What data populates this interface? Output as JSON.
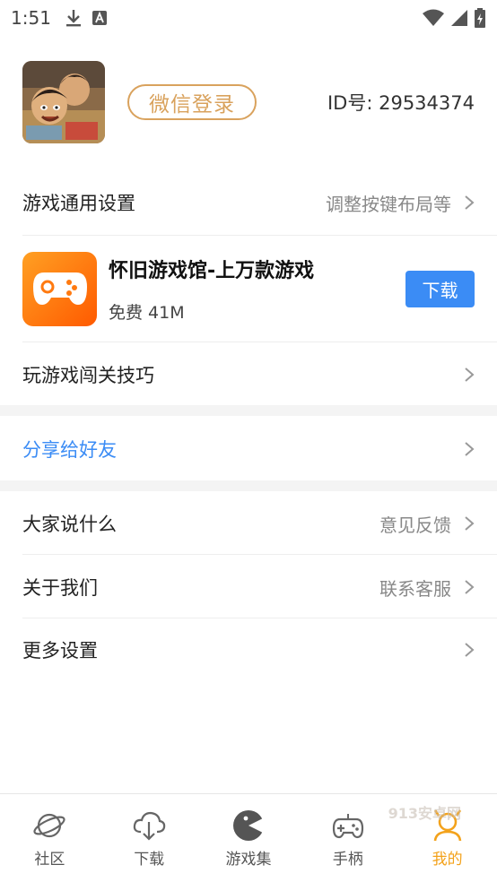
{
  "status_bar": {
    "time": "1:51"
  },
  "profile": {
    "login_label": "微信登录",
    "user_id": "ID号: 29534374"
  },
  "menu": {
    "game_settings": {
      "label": "游戏通用设置",
      "hint": "调整按键布局等"
    },
    "tips": {
      "label": "玩游戏闯关技巧"
    },
    "share": {
      "label": "分享给好友"
    },
    "feedback": {
      "label": "大家说什么",
      "hint": "意见反馈"
    },
    "about": {
      "label": "关于我们",
      "hint": "联系客服"
    },
    "more_settings": {
      "label": "更多设置"
    }
  },
  "ad": {
    "title": "怀旧游戏馆-上万款游戏",
    "subtitle": "免费 41M",
    "button": "下载"
  },
  "tabs": [
    {
      "label": "社区",
      "icon": "planet-icon"
    },
    {
      "label": "下载",
      "icon": "cloud-download-icon"
    },
    {
      "label": "游戏集",
      "icon": "pacman-icon"
    },
    {
      "label": "手柄",
      "icon": "gamepad-icon"
    },
    {
      "label": "我的",
      "icon": "user-icon"
    }
  ],
  "watermark": "913安卓网",
  "colors": {
    "accent": "#f3a21b",
    "login_border": "#d9a25d",
    "share_text": "#3b8cf5",
    "download_button": "#3b8cf5"
  }
}
